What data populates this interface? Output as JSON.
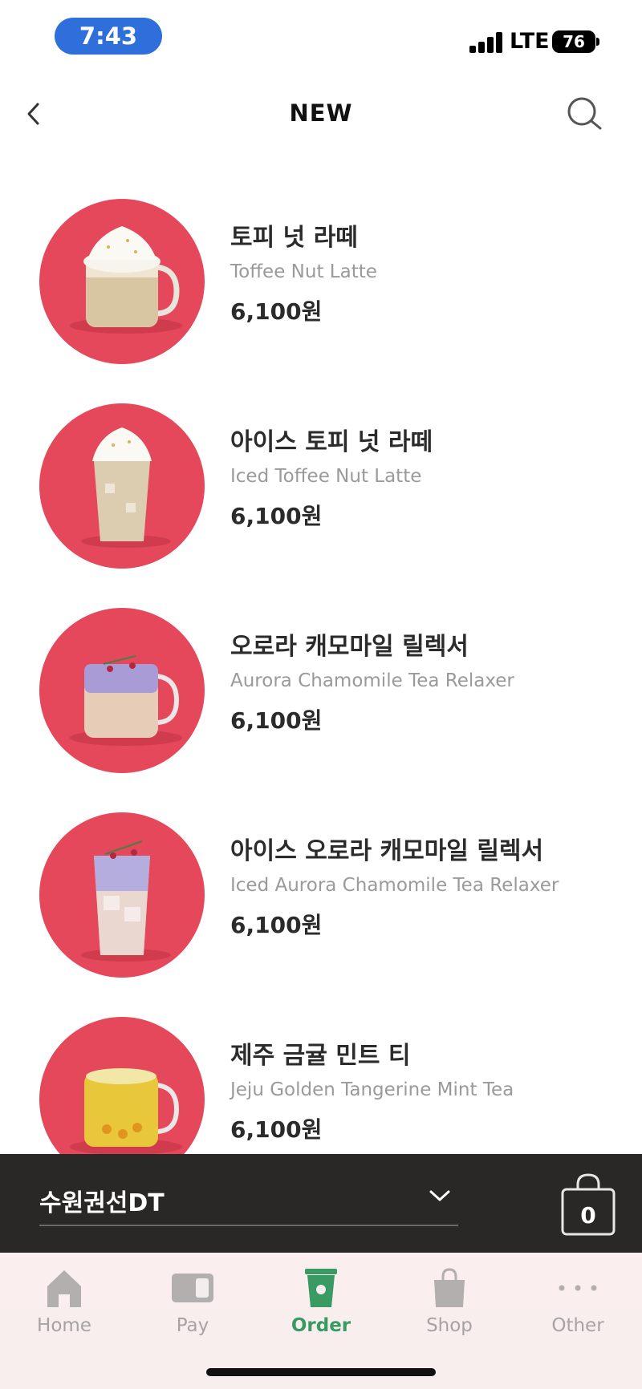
{
  "status_bar": {
    "time": "7:43",
    "network": "LTE",
    "battery": "76"
  },
  "nav": {
    "title": "NEW"
  },
  "menu_items": [
    {
      "name_ko": "토피 넛 라떼",
      "name_en": "Toffee Nut Latte",
      "price": "6,100원",
      "image": "hot-latte-whipped-cream"
    },
    {
      "name_ko": "아이스 토피 넛 라떼",
      "name_en": "Iced Toffee Nut Latte",
      "price": "6,100원",
      "image": "iced-latte-whipped-cream"
    },
    {
      "name_ko": "오로라 캐모마일 릴렉서",
      "name_en": "Aurora Chamomile Tea Relaxer",
      "price": "6,100원",
      "image": "hot-layered-tea"
    },
    {
      "name_ko": "아이스 오로라 캐모마일 릴렉서",
      "name_en": "Iced Aurora Chamomile Tea Relaxer",
      "price": "6,100원",
      "image": "iced-layered-tea"
    },
    {
      "name_ko": "제주 금귤 민트 티",
      "name_en": "Jeju Golden Tangerine Mint Tea",
      "price": "6,100원",
      "image": "hot-yellow-tea"
    }
  ],
  "store": {
    "name": "수원권선DT",
    "cart_count": "0"
  },
  "tab_bar": {
    "items": [
      {
        "label": "Home",
        "icon": "home-icon",
        "active": false
      },
      {
        "label": "Pay",
        "icon": "card-icon",
        "active": false
      },
      {
        "label": "Order",
        "icon": "cup-icon",
        "active": true
      },
      {
        "label": "Shop",
        "icon": "bag-icon",
        "active": false
      },
      {
        "label": "Other",
        "icon": "more-icon",
        "active": false
      }
    ]
  },
  "colors": {
    "accent_green": "#3a9a64",
    "thumb_red": "#e5485a",
    "store_bar": "#2a2827",
    "status_pill": "#2f6fdc"
  }
}
